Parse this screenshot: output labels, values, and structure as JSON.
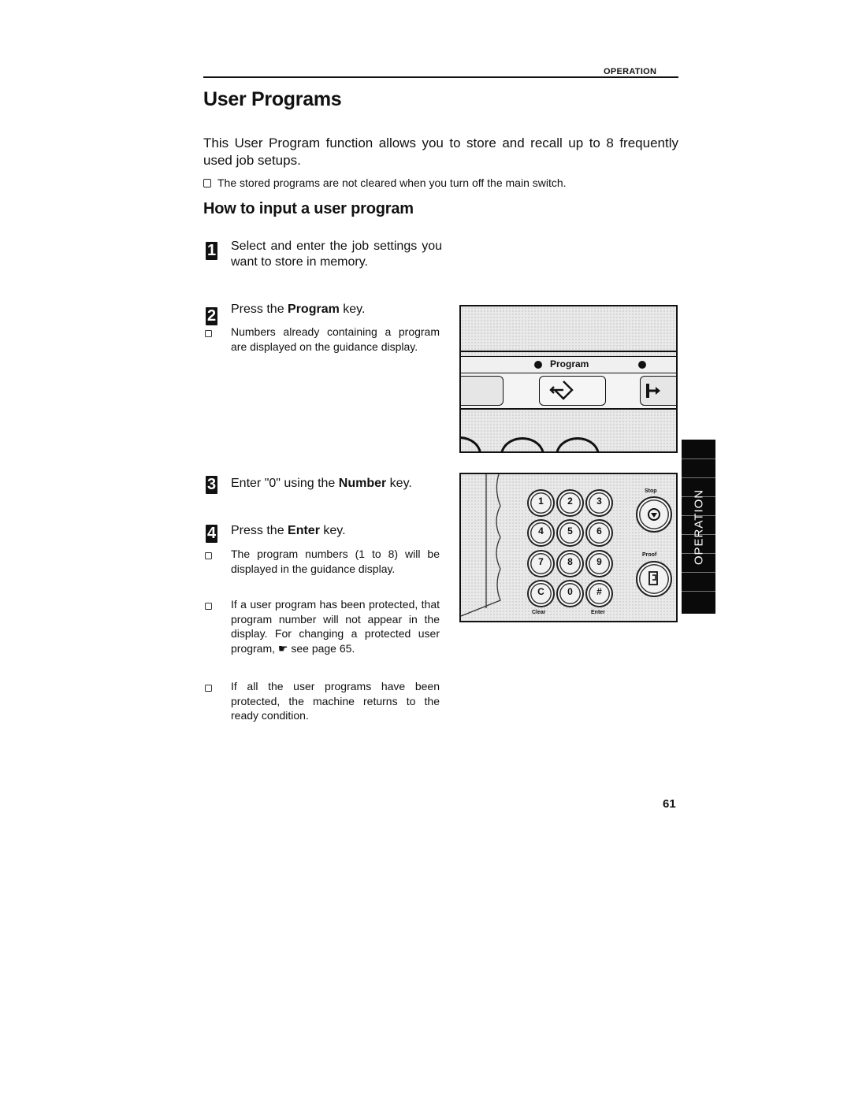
{
  "header": {
    "section": "OPERATION"
  },
  "title": "User Programs",
  "intro": "This User Program function allows you to store and recall up to 8 frequently used job setups.",
  "top_note": "The stored programs are not cleared when you turn off the main switch.",
  "subheading": "How to input a user program",
  "steps": [
    {
      "number": "1",
      "text": "Select and enter the job settings you want to store in memory."
    },
    {
      "number": "2",
      "text_before": "Press the ",
      "bold": "Program",
      "text_after": " key.",
      "notes": [
        "Numbers already containing a program are displayed on the guidance display."
      ]
    },
    {
      "number": "3",
      "text_before": "Enter \"0\" using the ",
      "bold": "Number",
      "text_after": " key."
    },
    {
      "number": "4",
      "text_before": "Press the ",
      "bold": "Enter",
      "text_after": " key.",
      "notes": [
        "The program numbers (1 to 8) will be displayed in the guidance display.",
        "If a user program has been protected, that program number will not appear in the display. For changing a protected user program, ☛ see page 65.",
        "If all the user programs have been protected, the machine returns to the ready condition."
      ]
    }
  ],
  "illustration_program": {
    "label": "Program",
    "icons": [
      "program-key-icon",
      "exit-key-icon"
    ]
  },
  "illustration_keypad": {
    "keys": [
      "1",
      "2",
      "3",
      "4",
      "5",
      "6",
      "7",
      "8",
      "9",
      "C",
      "0",
      "#"
    ],
    "labels": {
      "clear": "Clear",
      "enter": "Enter",
      "stop": "Stop",
      "proof": "Proof"
    }
  },
  "side_tab": "OPERATION",
  "page_number": "61"
}
